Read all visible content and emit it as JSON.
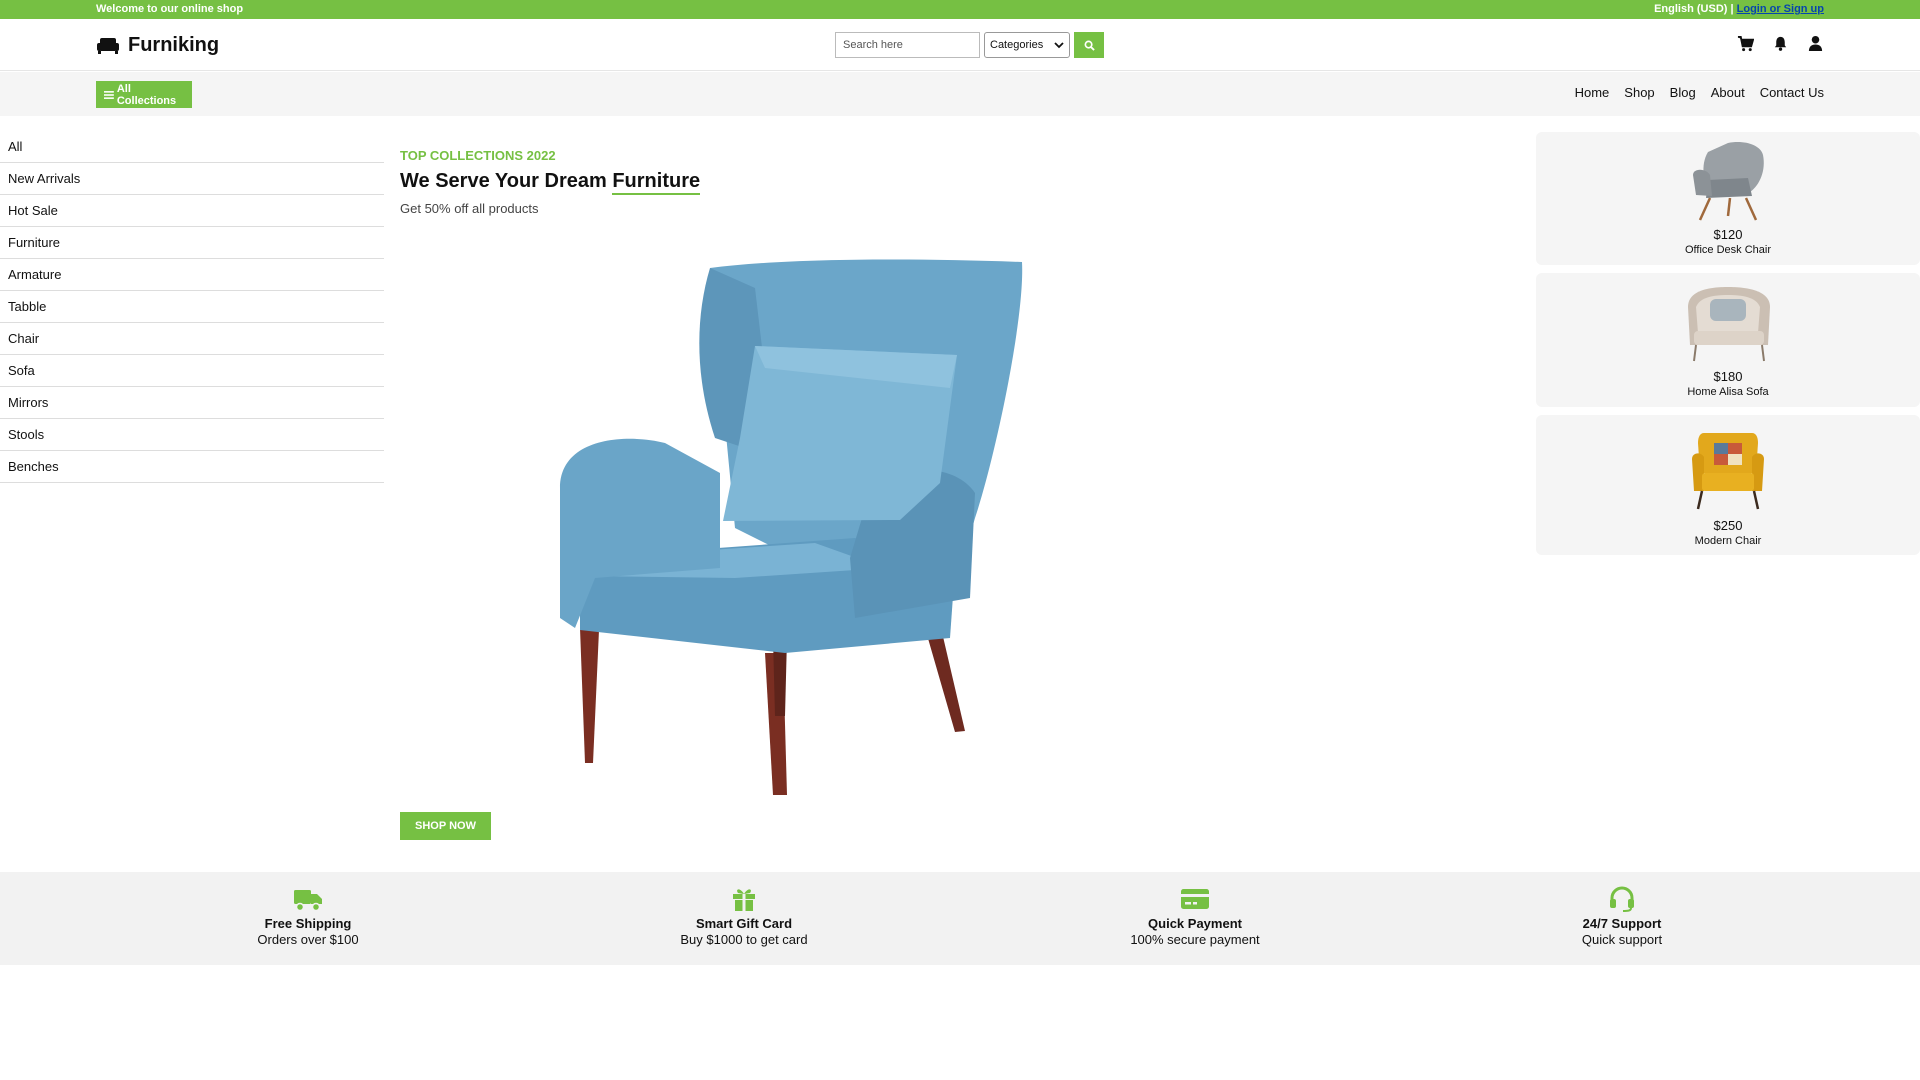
{
  "topbar": {
    "welcome": "Welcome to our online shop",
    "language": "English (USD) |",
    "login_link": "Login or Sign up"
  },
  "header": {
    "brand": "Furniking",
    "search_placeholder": "Search here",
    "category_select": "Categories",
    "icons": [
      "cart-icon",
      "bell-icon",
      "user-icon"
    ]
  },
  "nav": {
    "all_collections": "All Collections",
    "links": [
      "Home",
      "Shop",
      "Blog",
      "About",
      "Contact Us"
    ]
  },
  "sidebar": {
    "categories": [
      "All",
      "New Arrivals",
      "Hot Sale",
      "Furniture",
      "Armature",
      "Tabble",
      "Chair",
      "Sofa",
      "Mirrors",
      "Stools",
      "Benches"
    ]
  },
  "hero": {
    "subtitle": "TOP COLLECTIONS 2022",
    "title_prefix": "We Serve Your Dream ",
    "title_highlight": "Furniture",
    "description": "Get 50% off all products",
    "cta": "SHOP NOW"
  },
  "products": [
    {
      "price": "$120",
      "name": "Office Desk Chair"
    },
    {
      "price": "$180",
      "name": "Home Alisa Sofa"
    },
    {
      "price": "$250",
      "name": "Modern Chair"
    }
  ],
  "features": [
    {
      "icon": "truck-icon",
      "title": "Free Shipping",
      "subtitle": "Orders over $100"
    },
    {
      "icon": "gift-icon",
      "title": "Smart Gift Card",
      "subtitle": "Buy $1000 to get card"
    },
    {
      "icon": "credit-card-icon",
      "title": "Quick Payment",
      "subtitle": "100% secure payment"
    },
    {
      "icon": "headset-icon",
      "title": "24/7 Support",
      "subtitle": "Quick support"
    }
  ],
  "colors": {
    "accent": "#76c043",
    "nav_bg": "#f5f5f5",
    "hero_chair": "#6ba6c9"
  }
}
